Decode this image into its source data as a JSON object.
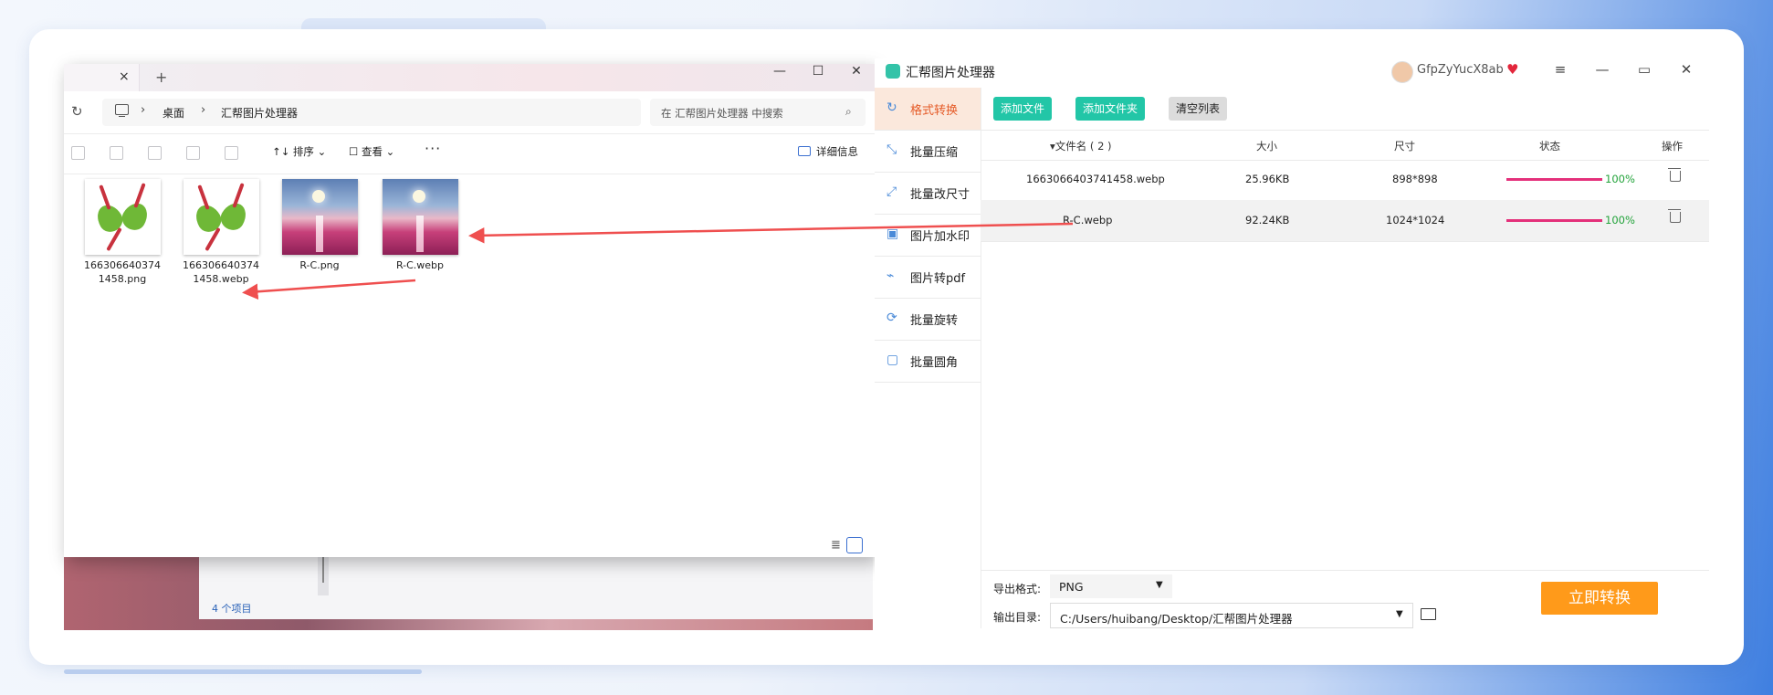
{
  "explorer": {
    "tab_close": "×",
    "new_tab": "+",
    "win_min": "—",
    "win_max": "☐",
    "win_close": "✕",
    "refresh": "↻",
    "breadcrumb": [
      "桌面",
      "汇帮图片处理器"
    ],
    "breadcrumb_sep": "›",
    "search_placeholder": "在 汇帮图片处理器 中搜索",
    "toolbar": {
      "sort": "↑↓ 排序 ⌄",
      "view": "☐ 查看 ⌄",
      "more": "···",
      "details": "详细信息"
    },
    "files": [
      {
        "name": "1663066403741458.png",
        "thumb": "zongzi"
      },
      {
        "name": "1663066403741458.webp",
        "thumb": "zongzi"
      },
      {
        "name": "R-C.png",
        "thumb": "night"
      },
      {
        "name": "R-C.webp",
        "thumb": "night"
      }
    ],
    "item_count": "4 个项目"
  },
  "app": {
    "title": "汇帮图片处理器",
    "username": "GfpZyYucX8ab",
    "vip_icon": "♥",
    "controls": {
      "menu": "≡",
      "min": "—",
      "max": "▭",
      "close": "✕"
    },
    "sidebar": [
      {
        "label": "格式转换",
        "icon": "↻",
        "active": true
      },
      {
        "label": "批量压缩",
        "icon": "⤡",
        "active": false
      },
      {
        "label": "批量改尺寸",
        "icon": "⤢",
        "active": false
      },
      {
        "label": "图片加水印",
        "icon": "▣",
        "active": false
      },
      {
        "label": "图片转pdf",
        "icon": "⌁",
        "active": false
      },
      {
        "label": "批量旋转",
        "icon": "⟳",
        "active": false
      },
      {
        "label": "批量圆角",
        "icon": "▢",
        "active": false
      }
    ],
    "buttons": {
      "add_file": "添加文件",
      "add_folder": "添加文件夹",
      "clear": "清空列表"
    },
    "columns": {
      "filename": "▾文件名 ( 2 )",
      "size": "大小",
      "dims": "尺寸",
      "status": "状态",
      "action": "操作"
    },
    "rows": [
      {
        "name": "1663066403741458.webp",
        "size": "25.96KB",
        "dims": "898*898",
        "progress": 100,
        "progress_label": "100%"
      },
      {
        "name": "R-C.webp",
        "size": "92.24KB",
        "dims": "1024*1024",
        "progress": 100,
        "progress_label": "100%"
      }
    ],
    "export_format_label": "导出格式:",
    "export_format": "PNG",
    "output_dir_label": "输出目录:",
    "output_dir": "C:/Users/huibang/Desktop/汇帮图片处理器",
    "convert_button": "立即转换"
  },
  "colors": {
    "accent_green": "#22c6a7",
    "active_orange": "#e55b28",
    "progress": "#e4307a",
    "convert": "#ff9a1a",
    "arrow": "#ef4f4f"
  }
}
